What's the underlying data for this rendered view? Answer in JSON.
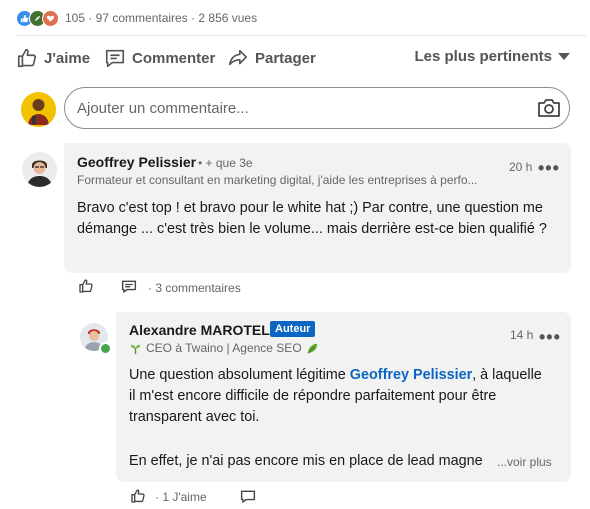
{
  "stats": {
    "text": "105 · 97 commentaires · 2 856 vues",
    "reaction_icons": [
      "like-reaction-icon",
      "celebrate-reaction-icon",
      "love-reaction-icon"
    ],
    "reaction_colors": [
      "#378fe9",
      "#44712e",
      "#df704d"
    ]
  },
  "actions": {
    "like": "J'aime",
    "comment": "Commenter",
    "share": "Partager",
    "sort": "Les plus pertinents"
  },
  "composer": {
    "placeholder": "Ajouter un commentaire..."
  },
  "comments": [
    {
      "author": "Geoffrey Pelissier",
      "degree": "• + que 3e",
      "headline": "Formateur et consultant en marketing digital, j'aide les entreprises à perfo...",
      "time": "20 h",
      "text": "Bravo c'est top ! et bravo pour le white hat ;) Par contre, une question me démange ... c'est très bien le volume... mais derrière est-ce bien qualifié ?",
      "replies_count": "· 3 commentaires"
    }
  ],
  "reply": {
    "author": "Alexandre MAROTEL",
    "badge": "Auteur",
    "headline": "CEO à Twaino | Agence SEO",
    "time": "14 h",
    "text_before": "Une question absolument légitime ",
    "mention": "Geoffrey Pelissier",
    "text_after": ", à laquelle il m'est encore difficile de répondre parfaitement pour être transparent avec toi.",
    "text_2": "En effet, je n'ai pas encore mis en place de lead magne",
    "more": "...voir plus",
    "likes": "· 1 J'aime"
  },
  "colors": {
    "accent": "#0a66c2",
    "bubble": "#f2f2f2",
    "online": "#45a34e"
  }
}
